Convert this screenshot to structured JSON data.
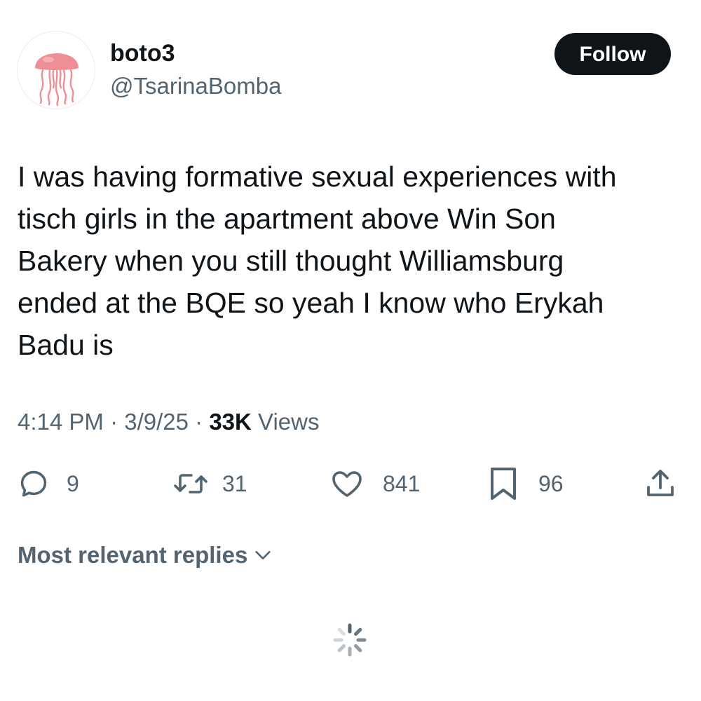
{
  "author": {
    "display_name": "boto3",
    "handle": "@TsarinaBomba",
    "avatar_icon": "jellyfish-icon"
  },
  "follow_button": {
    "label": "Follow"
  },
  "tweet": {
    "text": "I was having formative sexual experiences with\ntisch girls in the apartment above Win Son\nBakery when you still thought Williamsburg\nended at the BQE so yeah I know who Erykah\nBadu is",
    "time": "4:14 PM",
    "separator": " · ",
    "date": "3/9/25",
    "views_count": "33K",
    "views_label": " Views"
  },
  "actions": {
    "replies": {
      "icon": "reply-icon",
      "count": "9"
    },
    "reposts": {
      "icon": "repost-icon",
      "count": "31"
    },
    "likes": {
      "icon": "heart-icon",
      "count": "841"
    },
    "bookmarks": {
      "icon": "bookmark-icon",
      "count": "96"
    },
    "share": {
      "icon": "share-icon"
    }
  },
  "replies_sort": {
    "label": "Most relevant replies",
    "icon": "chevron-down-icon"
  },
  "colors": {
    "text_primary": "#0f1419",
    "text_secondary": "#536471",
    "button_bg": "#0f1419",
    "avatar_accent": "#ef8e95"
  }
}
